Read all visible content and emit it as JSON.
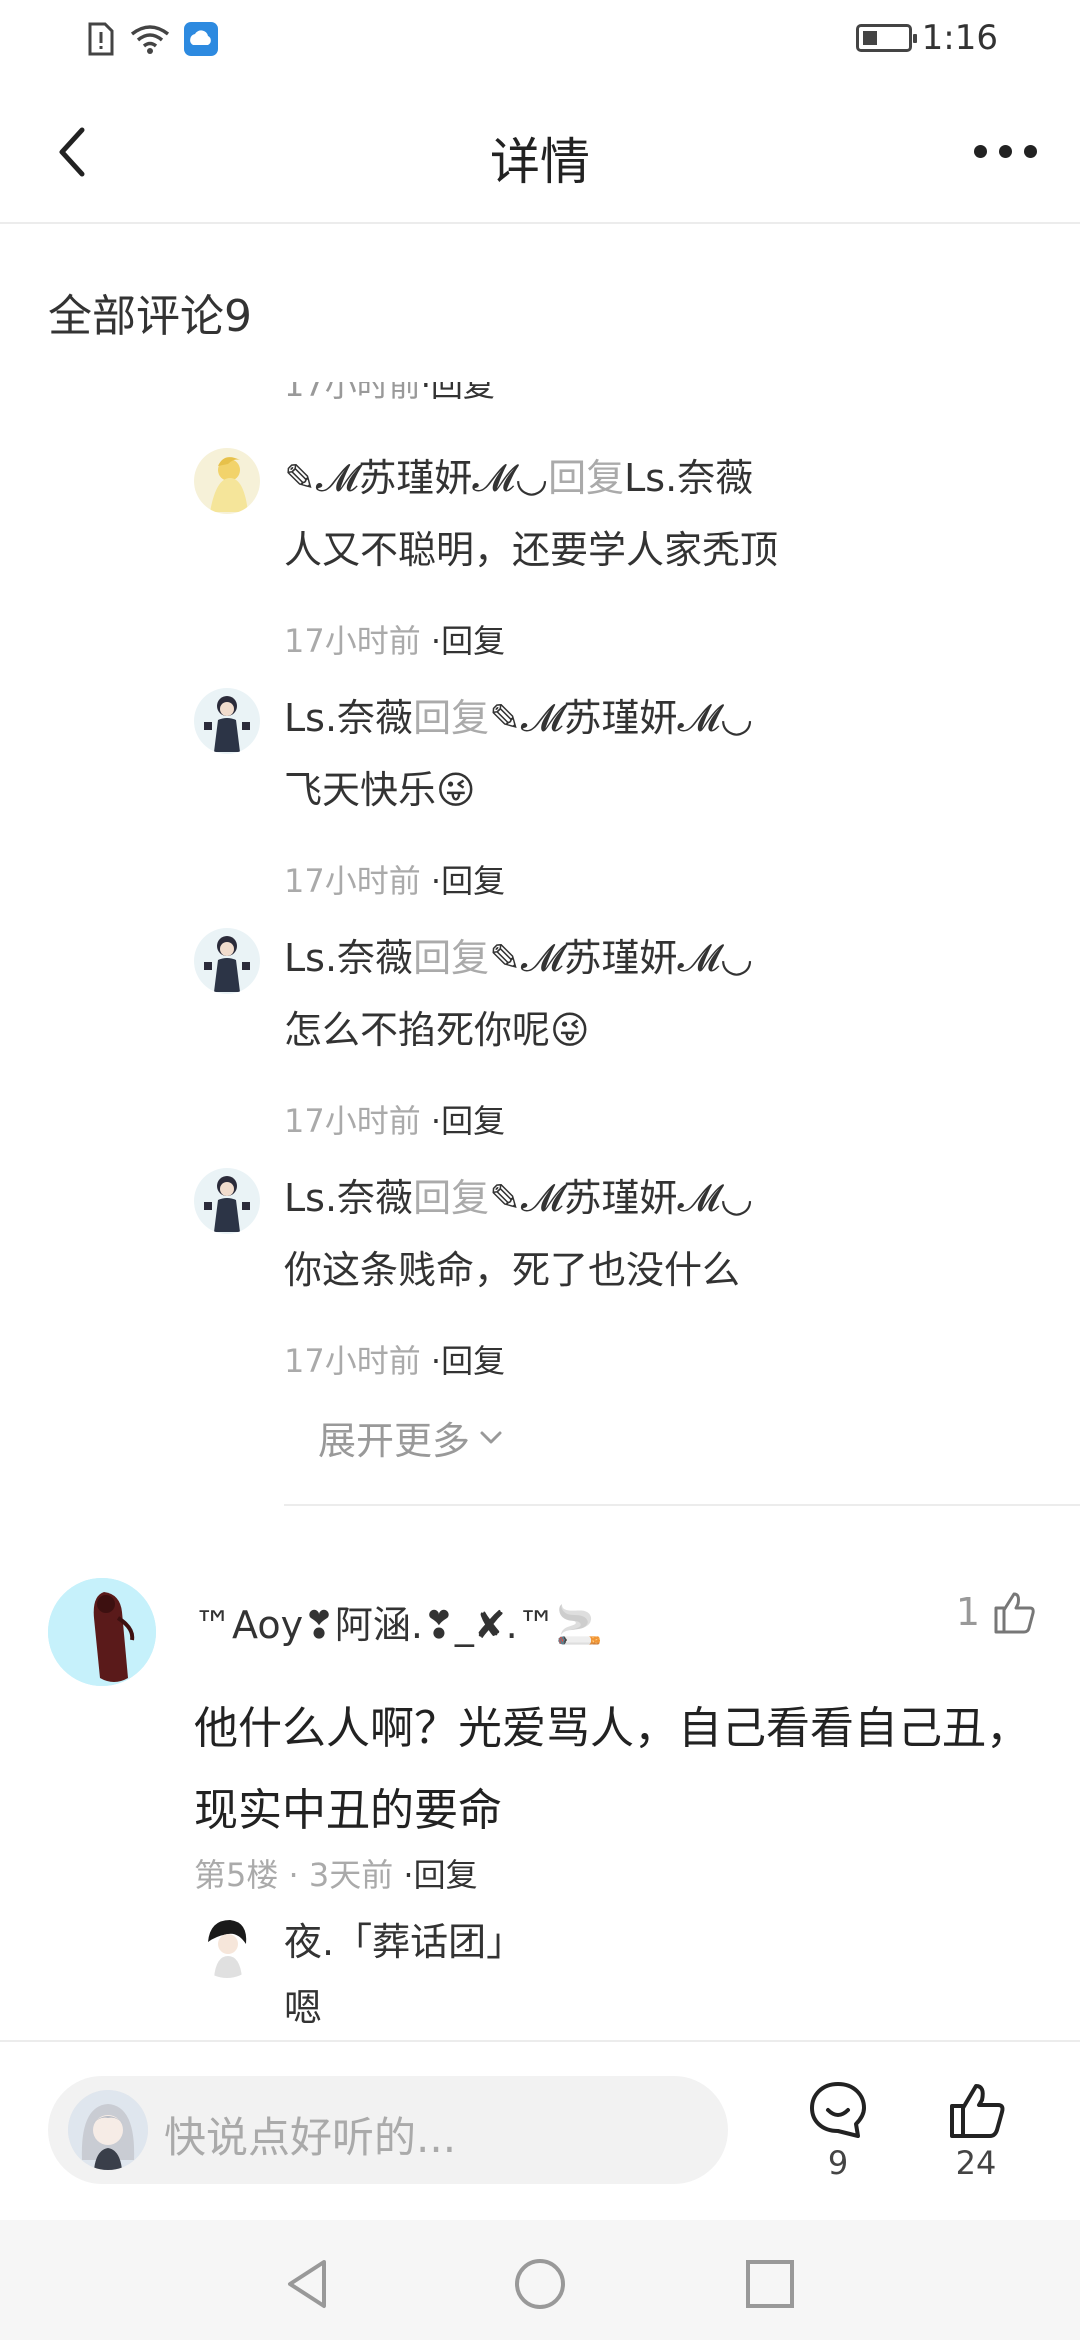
{
  "status_bar": {
    "time": "1:16"
  },
  "header": {
    "title": "详情"
  },
  "section": {
    "title": "全部评论9"
  },
  "partial_meta": {
    "time": "17小时前",
    "reply": "·回复"
  },
  "replies": [
    {
      "user": "✎𝓜苏瑾妍𝓜◡",
      "mid": "回复",
      "target": "Ls.奈薇",
      "text": "人又不聪明，还要学人家秃顶",
      "time": "17小时前",
      "reply": "·回复"
    },
    {
      "user": "Ls.奈薇",
      "mid": "回复",
      "target": "✎𝓜苏瑾妍𝓜◡",
      "text": "飞天快乐😜",
      "time": "17小时前",
      "reply": "·回复"
    },
    {
      "user": "Ls.奈薇",
      "mid": "回复",
      "target": "✎𝓜苏瑾妍𝓜◡",
      "text": "怎么不掐死你呢😜",
      "time": "17小时前",
      "reply": "·回复"
    },
    {
      "user": "Ls.奈薇",
      "mid": "回复",
      "target": "✎𝓜苏瑾妍𝓜◡",
      "text": "你这条贱命，死了也没什么",
      "time": "17小时前",
      "reply": "·回复"
    }
  ],
  "expand": {
    "label": "展开更多"
  },
  "comment": {
    "user": "™Aoy❣阿涵.❣_✘.™🚬",
    "likes": "1",
    "text": "他什么人啊？光爱骂人，自己看看自己丑，现实中丑的要命",
    "floor": "第5楼 · 3天前",
    "reply": "·回复"
  },
  "sub_reply": {
    "user": "夜.「葬话团」",
    "text": "嗯"
  },
  "bottom_bar": {
    "placeholder": "快说点好听的...",
    "comment_count": "9",
    "like_count": "24"
  }
}
